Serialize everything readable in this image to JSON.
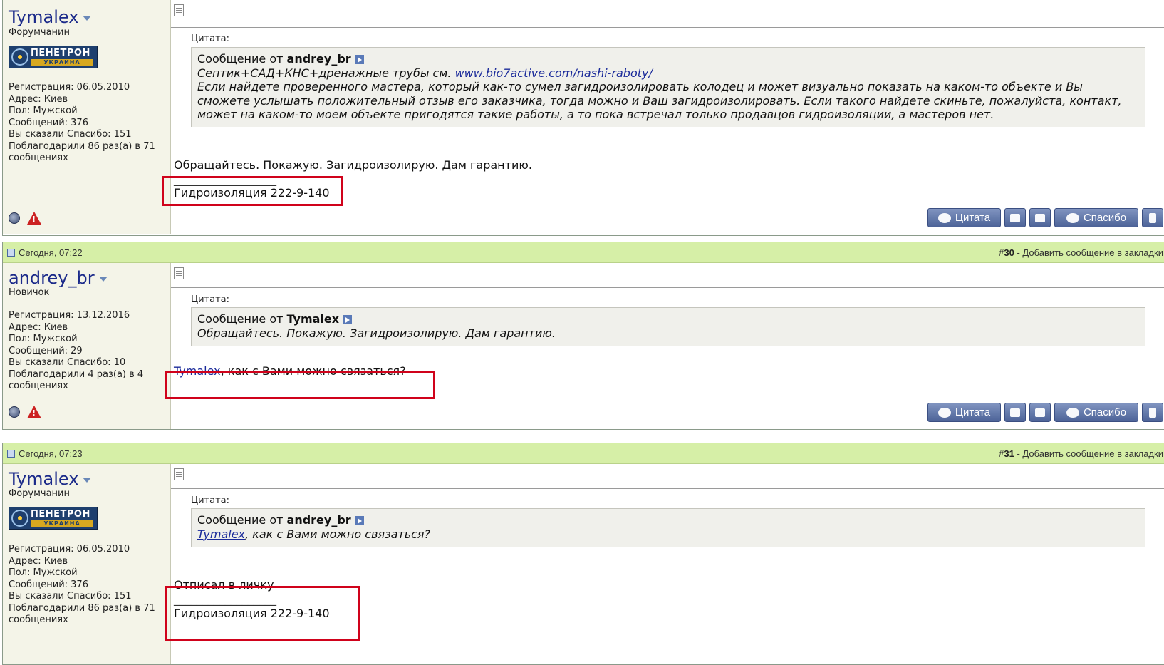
{
  "posts": [
    {
      "header": null,
      "author": {
        "name": "Tymalex",
        "rank": "Форумчанин",
        "has_logo": true
      },
      "logo": {
        "name": "ПЕНЕТРОН",
        "sub": "УКРАИНА"
      },
      "info": {
        "registration": "Регистрация: 06.05.2010",
        "address": "Адрес: Киев",
        "gender": "Пол: Мужской",
        "messages": "Сообщений: 376",
        "thanks_said": "Вы сказали Спасибо: 151",
        "thanked": "Поблагодарили 86 раз(а) в 71 сообщениях"
      },
      "quote": {
        "label": "Цитата:",
        "from_prefix": "Сообщение от ",
        "from_author": "andrey_br",
        "lines": [
          {
            "text": "Септик+САД+КНС+дренажные трубы см. ",
            "link": "www.bio7active.com/nashi-raboty/"
          },
          {
            "text": "Если найдете проверенного мастера, который как-то сумел загидроизолировать колодец и может визуально показать на каком-то объекте и Вы сможете услышать положительный отзыв его заказчика, тогда можно и Ваш загидроизолировать. Если такого найдете скиньте, пожалуйста, контакт, может на каком-то моем объекте пригодятся такие работы, а то пока встречал только продавцов гидроизоляции, а мастеров нет."
          }
        ]
      },
      "message": "Обращайтесь. Покажую. Загидроизолирую. Дам гарантию.",
      "signature_line": "__________________",
      "signature": "Гидроизоляция 222-9-140"
    },
    {
      "header": {
        "date": "Сегодня, 07:22",
        "post_no_prefix": "#",
        "post_no": "30",
        "bookmark": " - Добавить сообщение в закладки"
      },
      "author": {
        "name": "andrey_br",
        "rank": "Новичок",
        "has_logo": false
      },
      "info": {
        "registration": "Регистрация: 13.12.2016",
        "address": "Адрес: Киев",
        "gender": "Пол: Мужской",
        "messages": "Сообщений: 29",
        "thanks_said": "Вы сказали Спасибо: 10",
        "thanked": "Поблагодарили 4 раз(а) в 4 сообщениях"
      },
      "quote": {
        "label": "Цитата:",
        "from_prefix": "Сообщение от ",
        "from_author": "Tymalex",
        "lines": [
          {
            "text": "Обращайтесь. Покажую. Загидроизолирую. Дам гарантию."
          }
        ]
      },
      "message_link": "Tymalex",
      "message": ", как с Вами можно связаться?"
    },
    {
      "header": {
        "date": "Сегодня, 07:23",
        "post_no_prefix": "#",
        "post_no": "31",
        "bookmark": " - Добавить сообщение в закладки"
      },
      "author": {
        "name": "Tymalex",
        "rank": "Форумчанин",
        "has_logo": true
      },
      "logo": {
        "name": "ПЕНЕТРОН",
        "sub": "УКРАИНА"
      },
      "info": {
        "registration": "Регистрация: 06.05.2010",
        "address": "Адрес: Киев",
        "gender": "Пол: Мужской",
        "messages": "Сообщений: 376",
        "thanks_said": "Вы сказали Спасибо: 151",
        "thanked": "Поблагодарили 86 раз(а) в 71 сообщениях"
      },
      "quote": {
        "label": "Цитата:",
        "from_prefix": "Сообщение от ",
        "from_author": "andrey_br",
        "lines": [
          {
            "link": "Tymalex",
            "text": ", как с Вами можно связаться?"
          }
        ]
      },
      "message": "Отписал в личку",
      "signature_line": "__________________",
      "signature": "Гидроизоляция 222-9-140"
    }
  ],
  "buttons": {
    "quote": "Цитата",
    "thanks": "Спасибо"
  },
  "icons": {
    "online": "online-status-icon",
    "report": "report-warning-icon",
    "post": "post-document-icon",
    "goto": "goto-post-icon",
    "dropdown": "dropdown-arrow-icon"
  },
  "colors": {
    "header_bg": "#d6efa7",
    "username": "#1b2a8a",
    "highlight_box": "#d0021b",
    "button": "#4d6398"
  }
}
